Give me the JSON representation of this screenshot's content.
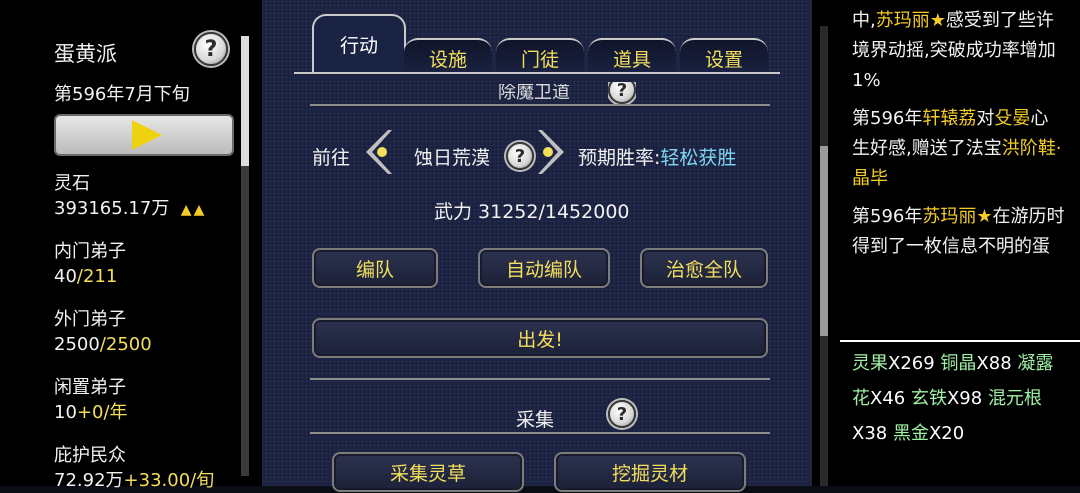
{
  "sect": {
    "name": "蛋黄派",
    "date": "第596年7月下旬"
  },
  "stats": {
    "lingshi_label": "灵石",
    "lingshi_value": "393165.17万",
    "lingshi_trend": "▲▲",
    "inner_label": "内门弟子",
    "inner_value": "40",
    "inner_max": "/211",
    "outer_label": "外门弟子",
    "outer_value": "2500",
    "outer_max": "/2500",
    "idle_label": "闲置弟子",
    "idle_value": "10",
    "idle_rate": "+0/年",
    "protect_label": "庇护民众",
    "protect_value": "72.92万",
    "protect_rate": "+33.00/旬"
  },
  "tabs": [
    "行动",
    "设施",
    "门徒",
    "道具",
    "设置"
  ],
  "action": {
    "subtitle": "除魔卫道",
    "goto_label": "前往",
    "destination": "蚀日荒漠",
    "rate_label": "预期胜率:",
    "rate_value": "轻松获胜",
    "power": "武力 31252/1452000",
    "btn_formation": "编队",
    "btn_auto_formation": "自动编队",
    "btn_heal": "治愈全队",
    "btn_depart": "出发!",
    "collect_title": "采集",
    "btn_herb": "采集灵草",
    "btn_mine": "挖掘灵材"
  },
  "log": {
    "e1_a": "中,",
    "e1_name": "苏玛丽★",
    "e1_b": "感受到了些许境界动摇,突破成功率增加1%",
    "e2_a": "第596年",
    "e2_name1": "轩辕荔",
    "e2_b": "对",
    "e2_name2": "殳晏",
    "e2_c": "心生好感,赠送了法宝",
    "e2_item": "洪阶鞋·晶毕",
    "e3_a": "第596年",
    "e3_name": "苏玛丽★",
    "e3_b": "在游历时得到了一枚信息不明的蛋"
  },
  "resources": {
    "r1": "灵果X269",
    "r2": "铜晶X88",
    "r3": "凝露花X46",
    "r4": "玄铁X98",
    "r5": "混元根X38",
    "r6": "黑金X20"
  },
  "colors": {
    "highlight_yellow": "#f4df5a",
    "name_gold": "#f4cc2a",
    "rate_cyan": "#7fd6f2",
    "herb_green": "#9ff0a5",
    "panel_navy": "#1a2140"
  }
}
